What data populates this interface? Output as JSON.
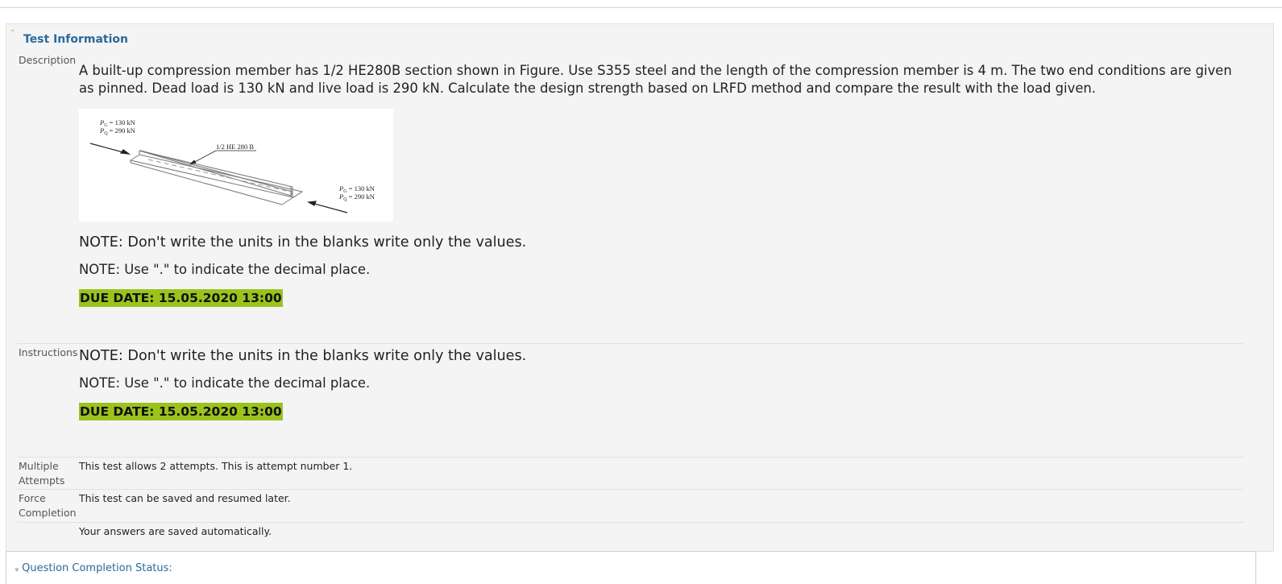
{
  "section": {
    "title": "Test Information",
    "collapse_icon": "chevron-up-icon"
  },
  "description": {
    "label": "Description",
    "text": "A built-up compression member has 1/2 HE280B section shown in Figure. Use S355 steel and the length of the compression member is 4 m. The two end conditions are given as pinned. Dead load is 130 kN and live load is 290 kN. Calculate the design strength based on LRFD method and compare the result with the load given.",
    "figure": {
      "left_load_g": "P",
      "left_load_g_sub": "G",
      "left_load_g_value": " = 130 kN",
      "left_load_q": "P",
      "left_load_q_sub": "Q",
      "left_load_q_value": " = 290 kN",
      "section_label": "1/2 HE 280 B",
      "right_load_g": "P",
      "right_load_g_sub": "G",
      "right_load_g_value": " = 130 kN",
      "right_load_q": "P",
      "right_load_q_sub": "Q",
      "right_load_q_value": " = 290 kN"
    },
    "note1": "NOTE:  Don't write the units in the blanks write only the values.",
    "note2": "NOTE: Use \".\" to indicate the decimal place.",
    "due_date": "DUE DATE: 15.05.2020 13:00"
  },
  "instructions": {
    "label": "Instructions",
    "note1": "NOTE:  Don't write the units in the blanks write only the values.",
    "note2": "NOTE: Use \".\" to indicate the decimal place.",
    "due_date": "DUE DATE: 15.05.2020 13:00"
  },
  "multiple_attempts": {
    "label_line1": "Multiple",
    "label_line2": "Attempts",
    "text": "This test allows 2 attempts. This is attempt number 1."
  },
  "force_completion": {
    "label_line1": "Force",
    "label_line2": "Completion",
    "text": "This test can be saved and resumed later."
  },
  "autosave": {
    "text": "Your answers are saved automatically."
  },
  "question_status": {
    "label": "Question Completion Status:",
    "expand_icon": "double-chevron-down-icon"
  },
  "colors": {
    "link": "#2a6a9c",
    "highlight": "#9ac31c",
    "caret": "#d89a1e"
  }
}
